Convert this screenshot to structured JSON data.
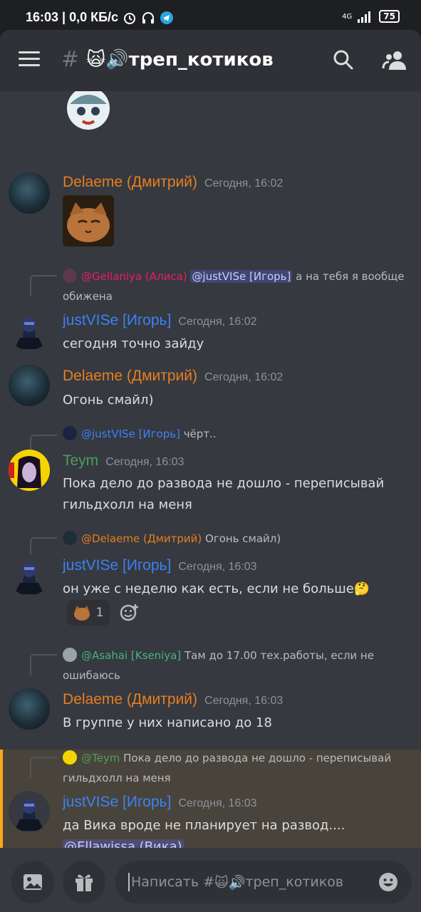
{
  "status_bar": {
    "time_speed": "16:03 | 0,0 КБ/с",
    "network": "4G",
    "battery": "75"
  },
  "header": {
    "hash": "#",
    "channel_emoji": "🙀🔊",
    "channel_name": "треп_котиков"
  },
  "messages": [
    {
      "author": "Delaeme (Дмитрий)",
      "time": "Сегодня, 16:02",
      "text": ""
    },
    {
      "reply": {
        "author": "@Gellaniya (Алиса)",
        "mention": "@justVISe [Игорь]",
        "text": "а на тебя я вообще обижена"
      },
      "author": "justVISe [Игорь]",
      "time": "Сегодня, 16:02",
      "text": "сегодня точно зайду"
    },
    {
      "author": "Delaeme (Дмитрий)",
      "time": "Сегодня, 16:02",
      "text": "Огонь смайл)"
    },
    {
      "reply": {
        "author": "@justVISe [Игорь]",
        "text": "чёрт.."
      },
      "author": "Teym",
      "time": "Сегодня, 16:03",
      "text": "Пока дело до развода не дошло - переписывай гильдхолл на меня"
    },
    {
      "reply": {
        "author": "@Delaeme (Дмитрий)",
        "text": "Огонь смайл)"
      },
      "author": "justVISe [Игорь]",
      "time": "Сегодня, 16:03",
      "text": "он уже с неделю как есть, если не больше🤔",
      "reaction_count": "1"
    },
    {
      "reply": {
        "author": "@Asahai [Kseniya]",
        "text": "Там до 17.00 тех.работы, если не ошибаюсь"
      },
      "author": "Delaeme (Дмитрий)",
      "time": "Сегодня, 16:03",
      "text": "В группе у них написано до 18"
    },
    {
      "reply": {
        "author": "@Teym",
        "text": "Пока дело до развода не дошло - переписывай гильдхолл на меня"
      },
      "author": "justVISe [Игорь]",
      "time": "Сегодня, 16:03",
      "text": "да Вика вроде не планирует на развод....",
      "mention": "@Ellawissa (Вика)"
    }
  ],
  "composer": {
    "placeholder_prefix": "Написать #",
    "placeholder_emoji": "🙀🔊",
    "placeholder_channel": "треп_котиков"
  }
}
